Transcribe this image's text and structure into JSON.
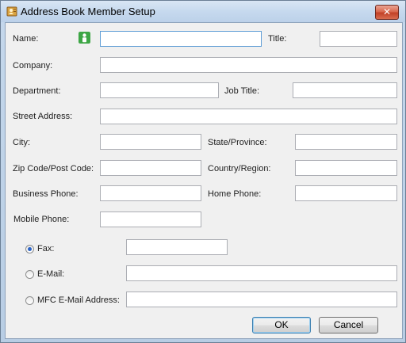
{
  "window": {
    "title": "Address Book Member Setup",
    "close_glyph": "✕"
  },
  "form": {
    "name_label": "Name:",
    "name_value": "",
    "title_label": "Title:",
    "title_value": "",
    "company_label": "Company:",
    "company_value": "",
    "department_label": "Department:",
    "department_value": "",
    "job_title_label": "Job Title:",
    "job_title_value": "",
    "street_label": "Street Address:",
    "street_value": "",
    "city_label": "City:",
    "city_value": "",
    "state_label": "State/Province:",
    "state_value": "",
    "zip_label": "Zip Code/Post Code:",
    "zip_value": "",
    "country_label": "Country/Region:",
    "country_value": "",
    "business_phone_label": "Business Phone:",
    "business_phone_value": "",
    "home_phone_label": "Home Phone:",
    "home_phone_value": "",
    "mobile_phone_label": "Mobile Phone:",
    "mobile_phone_value": ""
  },
  "destination": {
    "selected": "fax",
    "fax_label": "Fax:",
    "fax_value": "",
    "email_label": "E-Mail:",
    "email_value": "",
    "mfc_email_label": "MFC E-Mail Address:",
    "mfc_email_value": ""
  },
  "buttons": {
    "ok_label": "OK",
    "cancel_label": "Cancel"
  },
  "icons": {
    "title_icon": "address-book-icon",
    "name_icon": "contact-person-icon",
    "accent_green": "#3da645"
  }
}
